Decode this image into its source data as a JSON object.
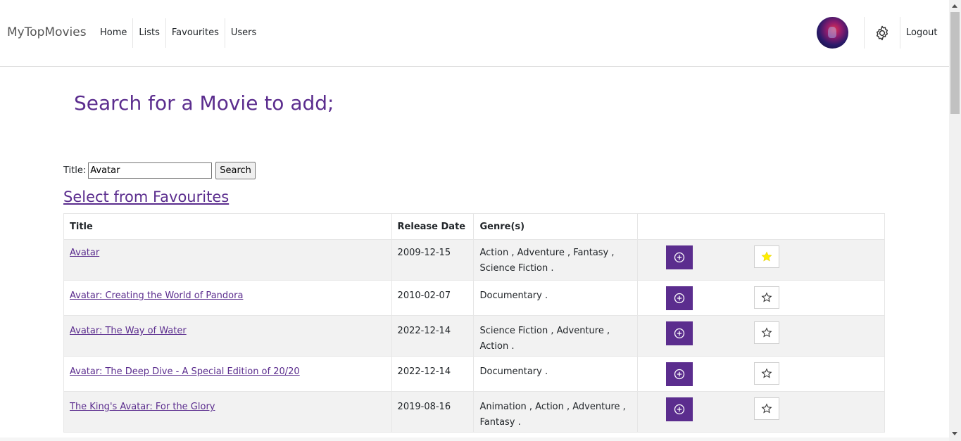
{
  "nav": {
    "brand": "MyTopMovies",
    "links": [
      "Home",
      "Lists",
      "Favourites",
      "Users"
    ],
    "logout": "Logout",
    "settings_icon": "gear-icon"
  },
  "page": {
    "title": "Search for a Movie to add;",
    "search_label": "Title:",
    "search_value": "Avatar",
    "search_button": "Search",
    "favourites_link": "Select from Favourites"
  },
  "table": {
    "headers": [
      "Title",
      "Release Date",
      "Genre(s)",
      ""
    ],
    "rows": [
      {
        "title": "Avatar",
        "date": "2009-12-15",
        "genres_line1": "Action ,  Adventure ,  Fantasy ,",
        "genres_line2": "Science Fiction .",
        "favourite": true
      },
      {
        "title": "Avatar: Creating the World of Pandora",
        "date": "2010-02-07",
        "genres_line1": "Documentary .",
        "genres_line2": "",
        "favourite": false
      },
      {
        "title": "Avatar: The Way of Water",
        "date": "2022-12-14",
        "genres_line1": "Science Fiction ,  Adventure ,",
        "genres_line2": "Action .",
        "favourite": false
      },
      {
        "title": "Avatar: The Deep Dive - A Special Edition of 20/20",
        "date": "2022-12-14",
        "genres_line1": "Documentary .",
        "genres_line2": "",
        "favourite": false
      },
      {
        "title": "The King's Avatar: For the Glory",
        "date": "2019-08-16",
        "genres_line1": "Animation ,  Action ,  Adventure ,",
        "genres_line2": "Fantasy .",
        "favourite": false
      }
    ]
  },
  "colors": {
    "accent": "#5b2d8e",
    "star_filled": "#ffee00"
  }
}
